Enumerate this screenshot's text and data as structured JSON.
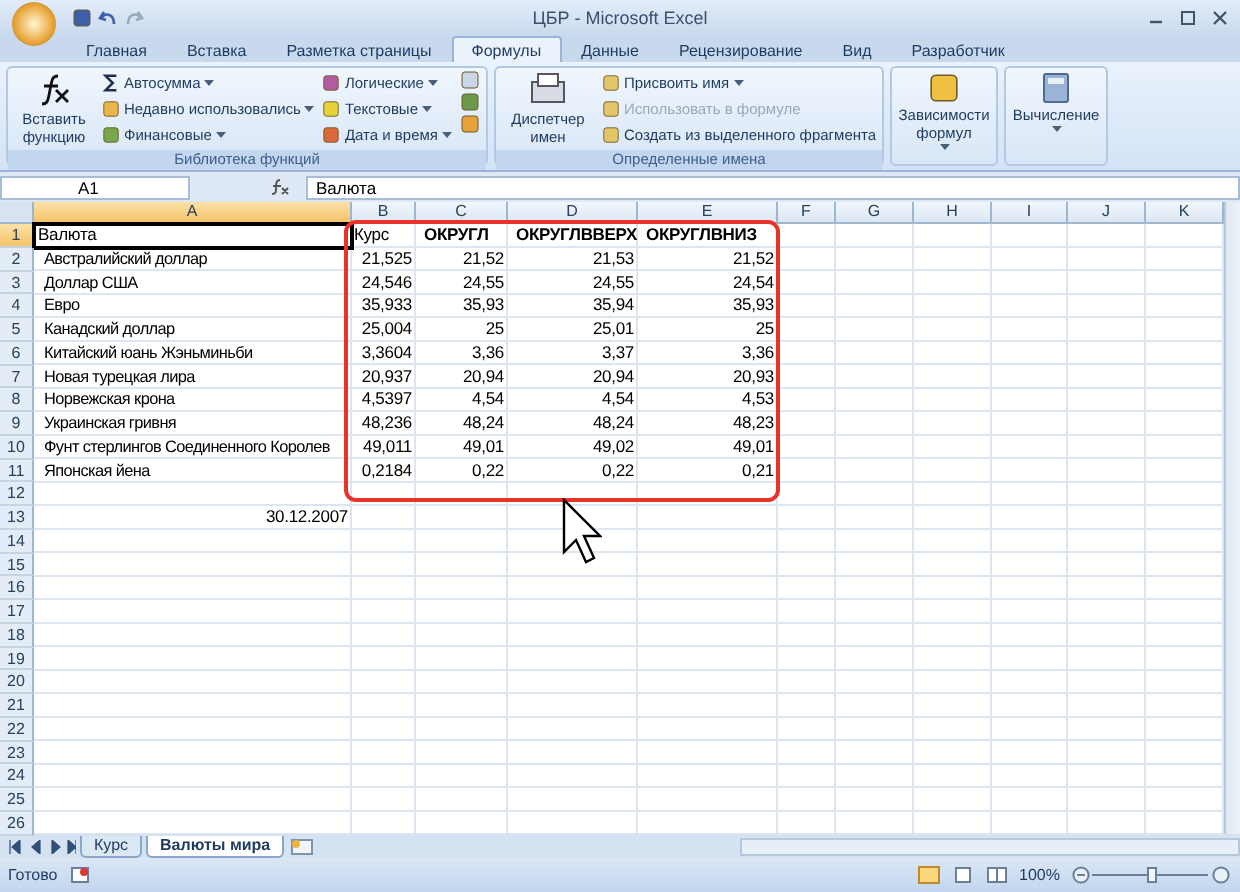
{
  "window": {
    "title": "ЦБР - Microsoft Excel"
  },
  "tabs": [
    {
      "label": "Главная",
      "selected": false
    },
    {
      "label": "Вставка",
      "selected": false
    },
    {
      "label": "Разметка страницы",
      "selected": false
    },
    {
      "label": "Формулы",
      "selected": true
    },
    {
      "label": "Данные",
      "selected": false
    },
    {
      "label": "Рецензирование",
      "selected": false
    },
    {
      "label": "Вид",
      "selected": false
    },
    {
      "label": "Разработчик",
      "selected": false
    }
  ],
  "ribbon": {
    "library": {
      "label": "Библиотека функций",
      "insert": "Вставить функцию",
      "items": [
        {
          "label": "Автосумма",
          "disabled": false
        },
        {
          "label": "Недавно использовались",
          "disabled": false
        },
        {
          "label": "Финансовые",
          "disabled": false
        },
        {
          "label": "Логические",
          "disabled": false
        },
        {
          "label": "Текстовые",
          "disabled": false
        },
        {
          "label": "Дата и время",
          "disabled": false
        }
      ]
    },
    "names": {
      "label": "Определенные имена",
      "manager": "Диспетчер имен",
      "items": [
        {
          "label": "Присвоить имя",
          "disabled": false
        },
        {
          "label": "Использовать в формуле",
          "disabled": true
        },
        {
          "label": "Создать из выделенного фрагмента",
          "disabled": false
        }
      ]
    },
    "big_buttons": [
      "Зависимости формул",
      "Вычисление"
    ]
  },
  "formula_bar": {
    "name_box": "A1",
    "formula": "Валюта"
  },
  "columns": [
    {
      "label": "A",
      "selected": true
    },
    {
      "label": "B",
      "selected": false
    },
    {
      "label": "C",
      "selected": false
    },
    {
      "label": "D",
      "selected": false
    },
    {
      "label": "E",
      "selected": false
    },
    {
      "label": "F",
      "selected": false
    },
    {
      "label": "G",
      "selected": false
    },
    {
      "label": "H",
      "selected": false
    },
    {
      "label": "I",
      "selected": false
    },
    {
      "label": "J",
      "selected": false
    },
    {
      "label": "K",
      "selected": false
    }
  ],
  "rows": [
    {
      "number": "1",
      "kind": "header",
      "active": true,
      "cells": [
        "Валюта",
        "Курс",
        "ОКРУГЛ",
        "ОКРУГЛВВЕРХ",
        "ОКРУГЛВНИЗ"
      ]
    },
    {
      "number": "2",
      "kind": "data",
      "active": false,
      "cells": [
        "Австралийский доллар",
        "21,525",
        "21,52",
        "21,53",
        "21,52"
      ]
    },
    {
      "number": "3",
      "kind": "data",
      "active": false,
      "cells": [
        "Доллар США",
        "24,546",
        "24,55",
        "24,55",
        "24,54"
      ]
    },
    {
      "number": "4",
      "kind": "data",
      "active": false,
      "cells": [
        "Евро",
        "35,933",
        "35,93",
        "35,94",
        "35,93"
      ]
    },
    {
      "number": "5",
      "kind": "data",
      "active": false,
      "cells": [
        "Канадский доллар",
        "25,004",
        "25",
        "25,01",
        "25"
      ]
    },
    {
      "number": "6",
      "kind": "data",
      "active": false,
      "cells": [
        "Китайский юань Жэньминьби",
        "3,3604",
        "3,36",
        "3,37",
        "3,36"
      ]
    },
    {
      "number": "7",
      "kind": "data",
      "active": false,
      "cells": [
        "Новая турецкая лира",
        "20,937",
        "20,94",
        "20,94",
        "20,93"
      ]
    },
    {
      "number": "8",
      "kind": "data",
      "active": false,
      "cells": [
        "Норвежская крона",
        "4,5397",
        "4,54",
        "4,54",
        "4,53"
      ]
    },
    {
      "number": "9",
      "kind": "data",
      "active": false,
      "cells": [
        "Украинская гривня",
        "48,236",
        "48,24",
        "48,24",
        "48,23"
      ]
    },
    {
      "number": "10",
      "kind": "data",
      "active": false,
      "cells": [
        "Фунт стерлингов Соединенного Королев",
        "49,011",
        "49,01",
        "49,02",
        "49,01"
      ]
    },
    {
      "number": "11",
      "kind": "data",
      "active": false,
      "cells": [
        "Японская йена",
        "0,2184",
        "0,22",
        "0,22",
        "0,21"
      ]
    },
    {
      "number": "12",
      "kind": "empty",
      "active": false
    },
    {
      "number": "13",
      "kind": "date",
      "active": false,
      "cells": [
        "30.12.2007"
      ]
    },
    {
      "number": "14",
      "kind": "empty",
      "active": false
    },
    {
      "number": "15",
      "kind": "empty",
      "active": false
    },
    {
      "number": "16",
      "kind": "empty",
      "active": false
    },
    {
      "number": "17",
      "kind": "empty",
      "active": false
    },
    {
      "number": "18",
      "kind": "empty",
      "active": false
    },
    {
      "number": "19",
      "kind": "empty",
      "active": false
    },
    {
      "number": "20",
      "kind": "empty",
      "active": false
    },
    {
      "number": "21",
      "kind": "empty",
      "active": false
    },
    {
      "number": "22",
      "kind": "empty",
      "active": false
    },
    {
      "number": "23",
      "kind": "empty",
      "active": false
    },
    {
      "number": "24",
      "kind": "empty",
      "active": false
    },
    {
      "number": "25",
      "kind": "empty",
      "active": false
    },
    {
      "number": "26",
      "kind": "empty",
      "active": false
    }
  ],
  "sheets": [
    {
      "label": "Курс",
      "selected": false
    },
    {
      "label": "Валюты мира",
      "selected": true
    }
  ],
  "status_bar": {
    "status": "Готово",
    "zoom": "100%",
    "zoom_slider": {
      "level": 0.5
    }
  }
}
